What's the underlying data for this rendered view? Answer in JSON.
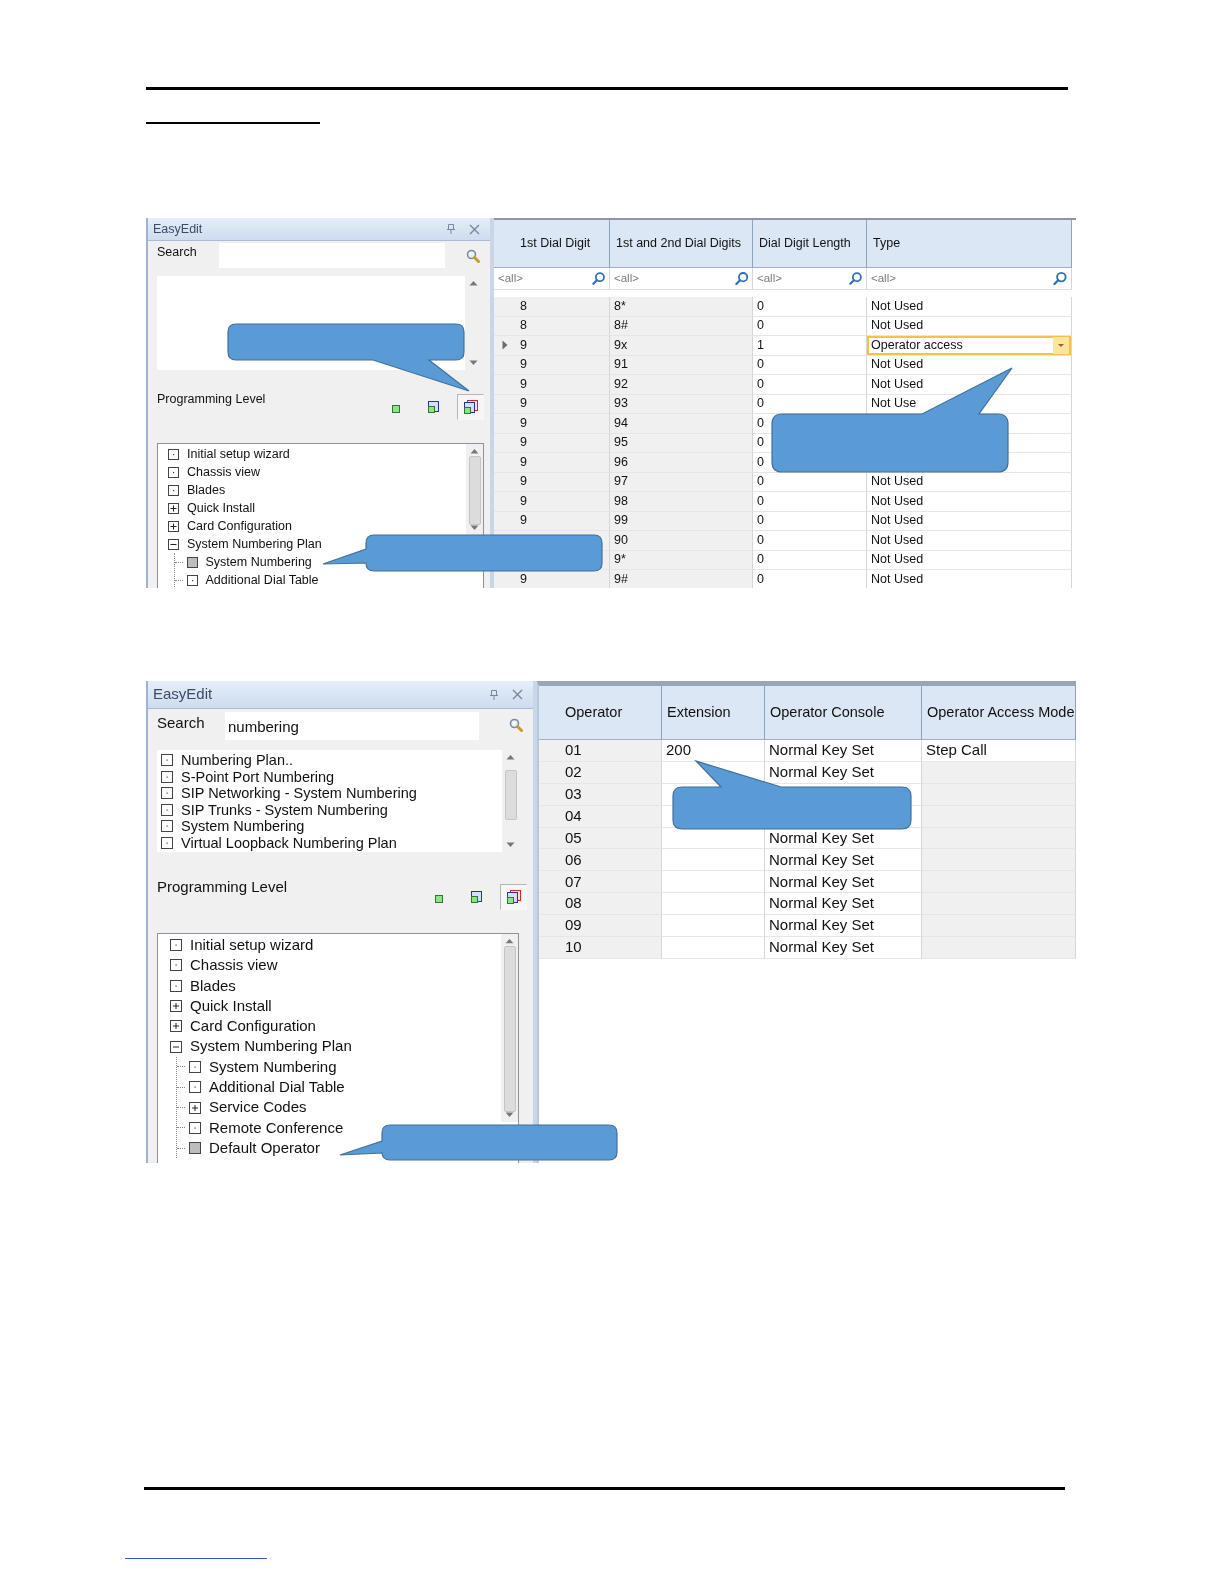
{
  "screenshots": [
    {
      "panel": {
        "title": "EasyEdit",
        "search": {
          "label": "Search"
        },
        "level_label": "Programming Level",
        "levels": [
          {
            "kind": "basic",
            "selected": false
          },
          {
            "kind": "intermediate",
            "selected": false
          },
          {
            "kind": "advanced",
            "selected": true
          }
        ],
        "tree": [
          {
            "label": "Initial setup wizard",
            "kind": "leaf",
            "selected": false
          },
          {
            "label": "Chassis view",
            "kind": "leaf",
            "selected": false
          },
          {
            "label": "Blades",
            "kind": "leaf",
            "selected": false
          },
          {
            "label": "Quick Install",
            "kind": "folder",
            "expanded": false,
            "selected": false
          },
          {
            "label": "Card Configuration",
            "kind": "folder",
            "expanded": false,
            "selected": false
          },
          {
            "label": "System Numbering Plan",
            "kind": "folder",
            "expanded": true,
            "selected": false,
            "children": [
              {
                "label": "System Numbering",
                "kind": "leaf",
                "selected": true
              },
              {
                "label": "Additional Dial Table",
                "kind": "leaf",
                "selected": false
              }
            ]
          }
        ]
      },
      "grid": {
        "columns": [
          {
            "label": "1st Dial Digit",
            "filter_placeholder": "<all>",
            "kind": "readonly"
          },
          {
            "label": "1st and 2nd Dial Digits",
            "filter_placeholder": "<all>",
            "kind": "readonly"
          },
          {
            "label": "Dial Digit Length",
            "filter_placeholder": "<all>",
            "kind": "editable"
          },
          {
            "label": "Type",
            "filter_placeholder": "<all>",
            "kind": "editable"
          }
        ],
        "rows": [
          {
            "selected": false,
            "cells": [
              "8",
              "8*",
              "0",
              "Not Used"
            ]
          },
          {
            "selected": false,
            "cells": [
              "8",
              "8#",
              "0",
              "Not Used"
            ]
          },
          {
            "selected": true,
            "cells": [
              "9",
              "9x",
              "1",
              "Operator access"
            ]
          },
          {
            "selected": false,
            "cells": [
              "9",
              "91",
              "0",
              "Not Used"
            ]
          },
          {
            "selected": false,
            "cells": [
              "9",
              "92",
              "0",
              "Not Used"
            ]
          },
          {
            "selected": false,
            "cells": [
              "9",
              "93",
              "0",
              "Not Use"
            ]
          },
          {
            "selected": false,
            "cells": [
              "9",
              "94",
              "0",
              null
            ]
          },
          {
            "selected": false,
            "cells": [
              "9",
              "95",
              "0",
              null
            ]
          },
          {
            "selected": false,
            "cells": [
              "9",
              "96",
              "0",
              null
            ]
          },
          {
            "selected": false,
            "cells": [
              "9",
              "97",
              "0",
              "Not Used"
            ]
          },
          {
            "selected": false,
            "cells": [
              "9",
              "98",
              "0",
              "Not Used"
            ]
          },
          {
            "selected": false,
            "cells": [
              "9",
              "99",
              "0",
              "Not Used"
            ]
          },
          {
            "selected": false,
            "cells": [
              null,
              "90",
              "0",
              "Not Used"
            ]
          },
          {
            "selected": false,
            "cells": [
              null,
              "9*",
              "0",
              "Not Used"
            ]
          },
          {
            "selected": false,
            "cells": [
              "9",
              "9#",
              "0",
              "Not Used"
            ]
          }
        ]
      }
    },
    {
      "panel": {
        "title": "EasyEdit",
        "search": {
          "label": "Search",
          "value": "numbering"
        },
        "results": [
          {
            "label": "Numbering Plan..",
            "selected": false
          },
          {
            "label": "S-Point Port Numbering",
            "selected": false
          },
          {
            "label": "SIP Networking - System Numbering",
            "selected": false
          },
          {
            "label": "SIP Trunks - System Numbering",
            "selected": false
          },
          {
            "label": "System Numbering",
            "selected": false
          },
          {
            "label": "Virtual Loopback Numbering Plan",
            "selected": false
          }
        ],
        "level_label": "Programming Level",
        "levels": [
          {
            "kind": "basic",
            "selected": false
          },
          {
            "kind": "intermediate",
            "selected": false
          },
          {
            "kind": "advanced",
            "selected": true
          }
        ],
        "tree": [
          {
            "label": "Initial setup wizard",
            "kind": "leaf",
            "selected": false
          },
          {
            "label": "Chassis view",
            "kind": "leaf",
            "selected": false
          },
          {
            "label": "Blades",
            "kind": "leaf",
            "selected": false
          },
          {
            "label": "Quick Install",
            "kind": "folder",
            "expanded": false,
            "selected": false
          },
          {
            "label": "Card Configuration",
            "kind": "folder",
            "expanded": false,
            "selected": false
          },
          {
            "label": "System Numbering Plan",
            "kind": "folder",
            "expanded": true,
            "selected": false,
            "children": [
              {
                "label": "System Numbering",
                "kind": "leaf",
                "selected": false
              },
              {
                "label": "Additional Dial Table",
                "kind": "leaf",
                "selected": false
              },
              {
                "label": "Service Codes",
                "kind": "folder",
                "expanded": false,
                "selected": false
              },
              {
                "label": "Remote Conference",
                "kind": "leaf",
                "selected": false
              },
              {
                "label": "Default Operator",
                "kind": "leaf",
                "selected": true
              }
            ]
          }
        ]
      },
      "grid": {
        "columns": [
          {
            "label": "Operator",
            "kind": "readonly"
          },
          {
            "label": "Extension",
            "kind": "editable"
          },
          {
            "label": "Operator Console",
            "kind": "editable"
          },
          {
            "label": "Operator Access Mode",
            "kind": "optional"
          }
        ],
        "rows": [
          {
            "selected": false,
            "cells": [
              "01",
              "200",
              "Normal Key Set",
              "Step Call"
            ]
          },
          {
            "selected": false,
            "cells": [
              "02",
              null,
              "Normal Key Set",
              null
            ]
          },
          {
            "selected": false,
            "cells": [
              "03",
              null,
              null,
              null
            ]
          },
          {
            "selected": false,
            "cells": [
              "04",
              null,
              null,
              null
            ]
          },
          {
            "selected": false,
            "cells": [
              "05",
              null,
              "Normal Key Set",
              null
            ]
          },
          {
            "selected": false,
            "cells": [
              "06",
              null,
              "Normal Key Set",
              null
            ]
          },
          {
            "selected": false,
            "cells": [
              "07",
              null,
              "Normal Key Set",
              null
            ]
          },
          {
            "selected": false,
            "cells": [
              "08",
              null,
              "Normal Key Set",
              null
            ]
          },
          {
            "selected": false,
            "cells": [
              "09",
              null,
              "Normal Key Set",
              null
            ]
          },
          {
            "selected": false,
            "cells": [
              "10",
              null,
              "Normal Key Set",
              null
            ]
          }
        ]
      }
    }
  ]
}
